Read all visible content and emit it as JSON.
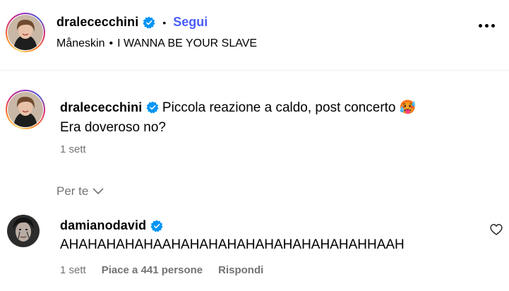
{
  "header": {
    "username": "dralececchini",
    "separator": "•",
    "follow_label": "Segui",
    "audio_artist": "Måneskin",
    "audio_separator": "•",
    "audio_title": "I WANNA BE YOUR SLAVE"
  },
  "caption": {
    "username": "dralececchini",
    "line1": "Piccola reazione a caldo, post concerto",
    "emoji": "🥵",
    "line2": "Era doveroso no?",
    "time": "1 sett"
  },
  "for_you": {
    "label": "Per te"
  },
  "comment": {
    "username": "damianodavid",
    "text": "AHAHAHAHAHAAHAHAHAHAHAHAHAHAHAHAHHAAH",
    "time": "1 sett",
    "likes": "Piace a 441 persone",
    "reply_label": "Rispondi"
  },
  "colors": {
    "link": "#4a5df9",
    "verified": "#0095f6",
    "muted": "#737373"
  },
  "icons": [
    "verified-badge-icon",
    "more-options-icon",
    "chevron-down-icon",
    "heart-icon"
  ]
}
